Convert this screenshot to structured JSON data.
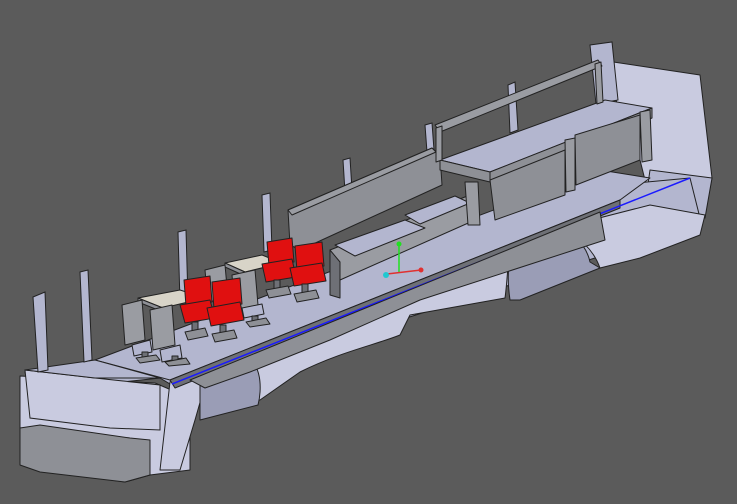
{
  "viewport": {
    "background": "#5b5b5b",
    "model": "bus-interior-cad-model"
  },
  "colors": {
    "hull_light": "#c9cbe0",
    "hull_mid": "#b3b6cf",
    "hull_dark": "#9a9db6",
    "interior_gray": "#8e9096",
    "interior_dark": "#6e7076",
    "seat_gray": "#9a9ca2",
    "seat_red": "#e01010",
    "table_top": "#d8d4c8",
    "outline": "#222222",
    "floor_edge": "#1a1aff"
  },
  "axis_gizmo": {
    "x_color": "#e03030",
    "y_color": "#20e020",
    "z_color": "#20c8d0"
  }
}
